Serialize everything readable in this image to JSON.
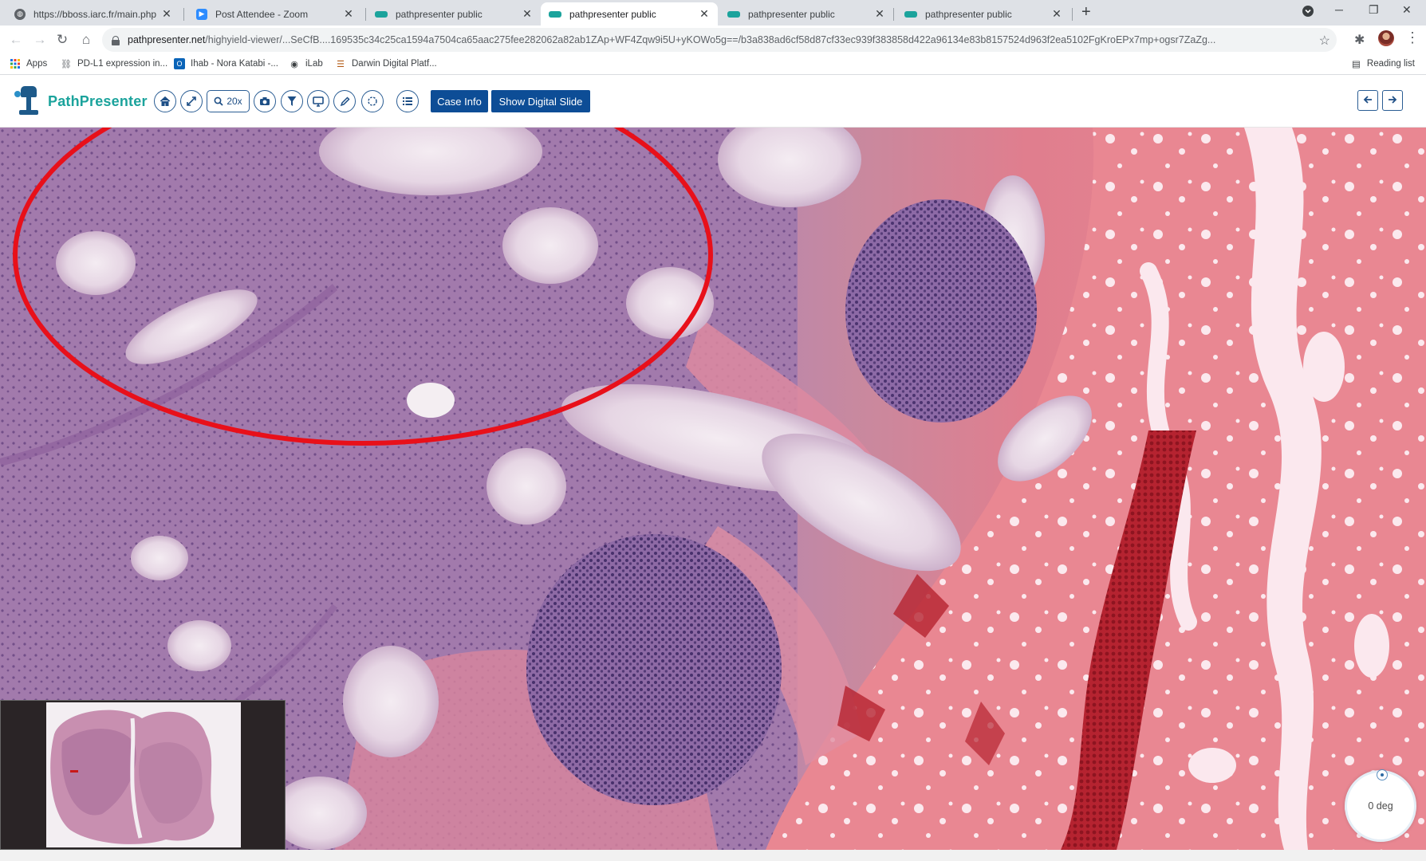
{
  "browser": {
    "tabs": [
      {
        "label": "https://bboss.iarc.fr/main.php",
        "icon": "globe-icon",
        "active": false
      },
      {
        "label": "Post Attendee - Zoom",
        "icon": "zoom-icon",
        "active": false
      },
      {
        "label": "pathpresenter public",
        "icon": "pathpresenter-icon",
        "active": false
      },
      {
        "label": "pathpresenter public",
        "icon": "pathpresenter-icon",
        "active": true
      },
      {
        "label": "pathpresenter public",
        "icon": "pathpresenter-icon",
        "active": false
      },
      {
        "label": "pathpresenter public",
        "icon": "pathpresenter-icon",
        "active": false
      }
    ],
    "close_glyph": "✕",
    "new_tab_glyph": "+",
    "url_host": "pathpresenter.net",
    "url_path": "/highyield-viewer/...SeCfB....169535c34c25ca1594a7504ca65aac275fee282062a82ab1ZAp+WF4Zqw9i5U+yKOWo5g==/b3a838ad6cf58d87cf33ec939f383858d422a96134e83b8157524d963f2ea5102FgKroEPx7mp+ogsr7ZaZg...",
    "bookmarks": [
      {
        "label": "Apps",
        "icon": "apps-grid-icon"
      },
      {
        "label": "PD-L1 expression in...",
        "icon": "link-icon"
      },
      {
        "label": "Ihab - Nora Katabi -...",
        "icon": "outlook-icon"
      },
      {
        "label": "iLab",
        "icon": "ilab-icon"
      },
      {
        "label": "Darwin Digital Platf...",
        "icon": "darwin-icon"
      }
    ],
    "reading_list": "Reading list"
  },
  "app": {
    "brand": "PathPresenter",
    "zoom_level": "20x",
    "case_info_label": "Case Info",
    "show_slide_label": "Show Digital Slide",
    "tools": [
      "home-icon",
      "expand-icon",
      "zoom-icon",
      "camera-icon",
      "filter-icon",
      "monitor-icon",
      "pencil-icon",
      "lasso-icon",
      "list-icon"
    ],
    "prev_label": "previous-slide",
    "next_label": "next-slide"
  },
  "viewer": {
    "rotation": "0 deg",
    "annotation_color": "#e8101a",
    "annotation_shape": "ellipse"
  },
  "colors": {
    "brand_teal": "#1ba39c",
    "brand_blue": "#0d4d96",
    "stain_purple": "#9a6ea8",
    "stain_pink": "#e98a95",
    "rbc_red": "#b8202c"
  }
}
